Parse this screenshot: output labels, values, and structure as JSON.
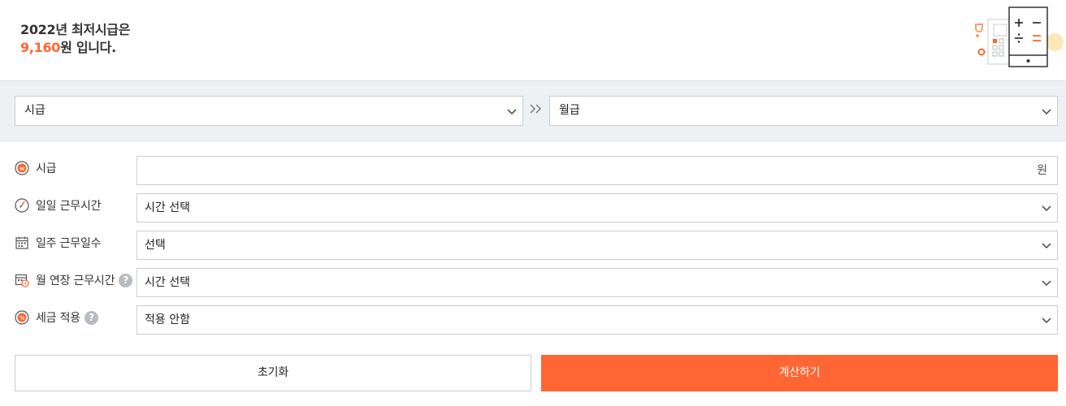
{
  "header": {
    "line1": "2022년 최저시급은",
    "wage_value": "9,160",
    "line2_suffix": "원 입니다."
  },
  "converter": {
    "from_value": "시급",
    "to_value": "월급"
  },
  "rows": [
    {
      "label": "시급",
      "value": "",
      "unit": "원"
    },
    {
      "label": "일일 근무시간",
      "value": "시간 선택"
    },
    {
      "label": "일주 근무일수",
      "value": "선택"
    },
    {
      "label": "월 연장 근무시간",
      "value": "시간 선택",
      "help": "?"
    },
    {
      "label": "세금 적용",
      "value": "적용 안함",
      "help": "?"
    }
  ],
  "buttons": {
    "reset": "초기화",
    "calculate": "계산하기"
  },
  "colors": {
    "accent": "#ff6633",
    "bar_bg": "#eef1f4",
    "border": "#c9ced3"
  },
  "icons": {
    "wage_row": "won-coin-icon",
    "hours_row": "clock-icon",
    "days_row": "calendar-icon",
    "overtime_row": "calendar-clock-icon",
    "tax_row": "percent-icon",
    "dropdown": "chevron-down-icon",
    "convert": "double-chevron-right-icon",
    "illustration": "calculator-icon"
  }
}
